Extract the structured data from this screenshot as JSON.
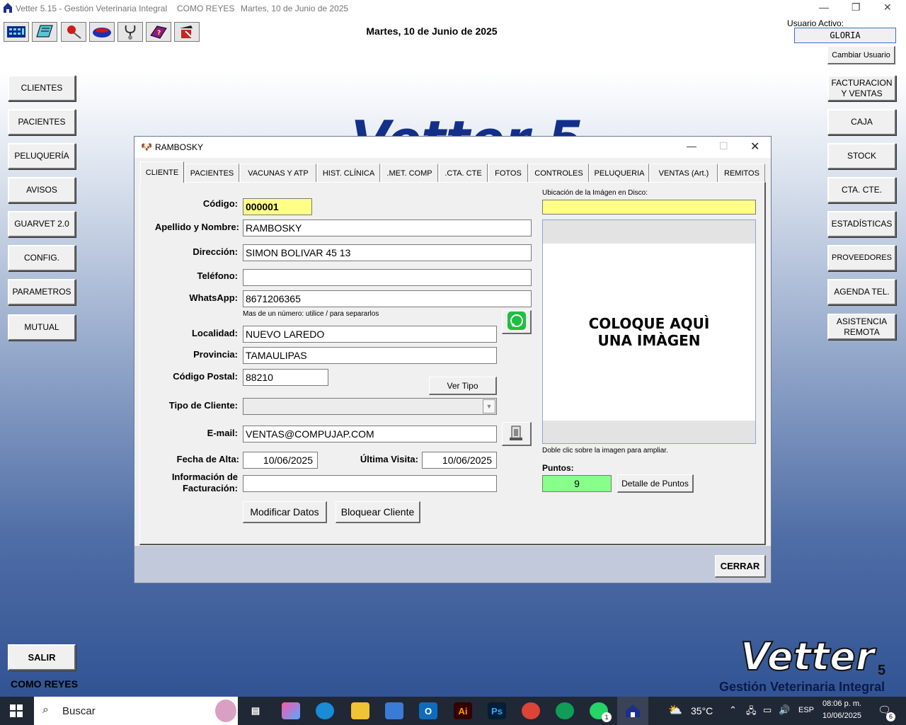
{
  "window": {
    "title": "Vetter 5.15 - Gestión Veterinaria Integral",
    "user_label": "COMO REYES",
    "date_label": "Martes, 10 de Junio de 2025"
  },
  "header": {
    "date": "Martes, 10 de Junio de 2025",
    "active_user_label": "Usuario Activo:",
    "active_user": "GLORIA",
    "change_user": "Cambiar Usuario"
  },
  "toolbar_icons": [
    "calculator-icon",
    "notebook-icon",
    "pin-icon",
    "pet-bowl-icon",
    "stethoscope-icon",
    "help-book-icon",
    "tools-icon"
  ],
  "left_menu": [
    "CLIENTES",
    "PACIENTES",
    "PELUQUERÍA",
    "AVISOS",
    "GUARVET 2.0",
    "CONFIG.",
    "PARAMETROS",
    "MUTUAL"
  ],
  "right_menu": {
    "facturacion_1": "FACTURACION",
    "facturacion_2": "Y VENTAS",
    "caja": "CAJA",
    "stock": "STOCK",
    "cta_cte": "CTA. CTE.",
    "estadisticas": "ESTADÍSTICAS",
    "proveedores": "PROVEEDORES",
    "agenda": "AGENDA TEL.",
    "asistencia_1": "ASISTENCIA",
    "asistencia_2": "REMOTA"
  },
  "exit": "SALIR",
  "footer_user": "COMO REYES",
  "watermark_bg": "Vetter 5",
  "brand": {
    "name": "Vetter",
    "version": "5",
    "tagline": "Gestión Veterinaria Integral"
  },
  "dialog": {
    "title": "RAMBOSKY",
    "tabs": [
      "CLIENTE",
      "PACIENTES",
      "VACUNAS Y ATP",
      "HIST. CLÍNICA",
      ".MET. COMP",
      ".CTA. CTE",
      "FOTOS",
      "CONTROLES",
      "PELUQUERIA",
      "VENTAS (Art.)",
      "REMITOS"
    ],
    "labels": {
      "codigo": "Código:",
      "nombre": "Apellido y Nombre:",
      "direccion": "Dirección:",
      "telefono": "Teléfono:",
      "whatsapp": "WhatsApp:",
      "whatsapp_hint": "Mas de un número: utilice / para separarlos",
      "localidad": "Localidad:",
      "provincia": "Provincia:",
      "cp": "Código Postal:",
      "tipo": "Tipo de Cliente:",
      "email": "E-mail:",
      "alta": "Fecha de Alta:",
      "ultima": "Última Visita:",
      "info_1": "Información de",
      "info_2": "Facturación:",
      "image_path": "Ubicación de la Imágen en Disco:",
      "image_hint": "Doble clic sobre la imagen para ampliar.",
      "puntos": "Puntos:"
    },
    "values": {
      "codigo": "000001",
      "nombre": "RAMBOSKY",
      "direccion": "SIMON BOLIVAR 45 13",
      "telefono": "",
      "whatsapp": "8671206365",
      "localidad": "NUEVO LAREDO",
      "provincia": "TAMAULIPAS",
      "cp": "88210",
      "tipo": "",
      "email": "VENTAS@COMPUJAP.COM",
      "alta": "10/06/2025",
      "ultima": "10/06/2025",
      "info": "",
      "image_path": "",
      "puntos": "9"
    },
    "image_placeholder_1": "COLOQUE AQUÌ",
    "image_placeholder_2": "UNA IMÀGEN",
    "buttons": {
      "ver_tipo": "Ver Tipo",
      "modificar": "Modificar Datos",
      "bloquear": "Bloquear Cliente",
      "detalle_puntos": "Detalle de Puntos",
      "cerrar": "CERRAR"
    }
  },
  "taskbar": {
    "search": "Buscar",
    "weather": "35°C",
    "lang": "ESP",
    "time": "08:06 p. m.",
    "date": "10/06/2025",
    "notifications": "6",
    "whatsapp_badge": "1"
  },
  "colors": {
    "field_yellow": "#ffff88",
    "field_green": "#88ff88",
    "brand_blue": "#12308a"
  }
}
